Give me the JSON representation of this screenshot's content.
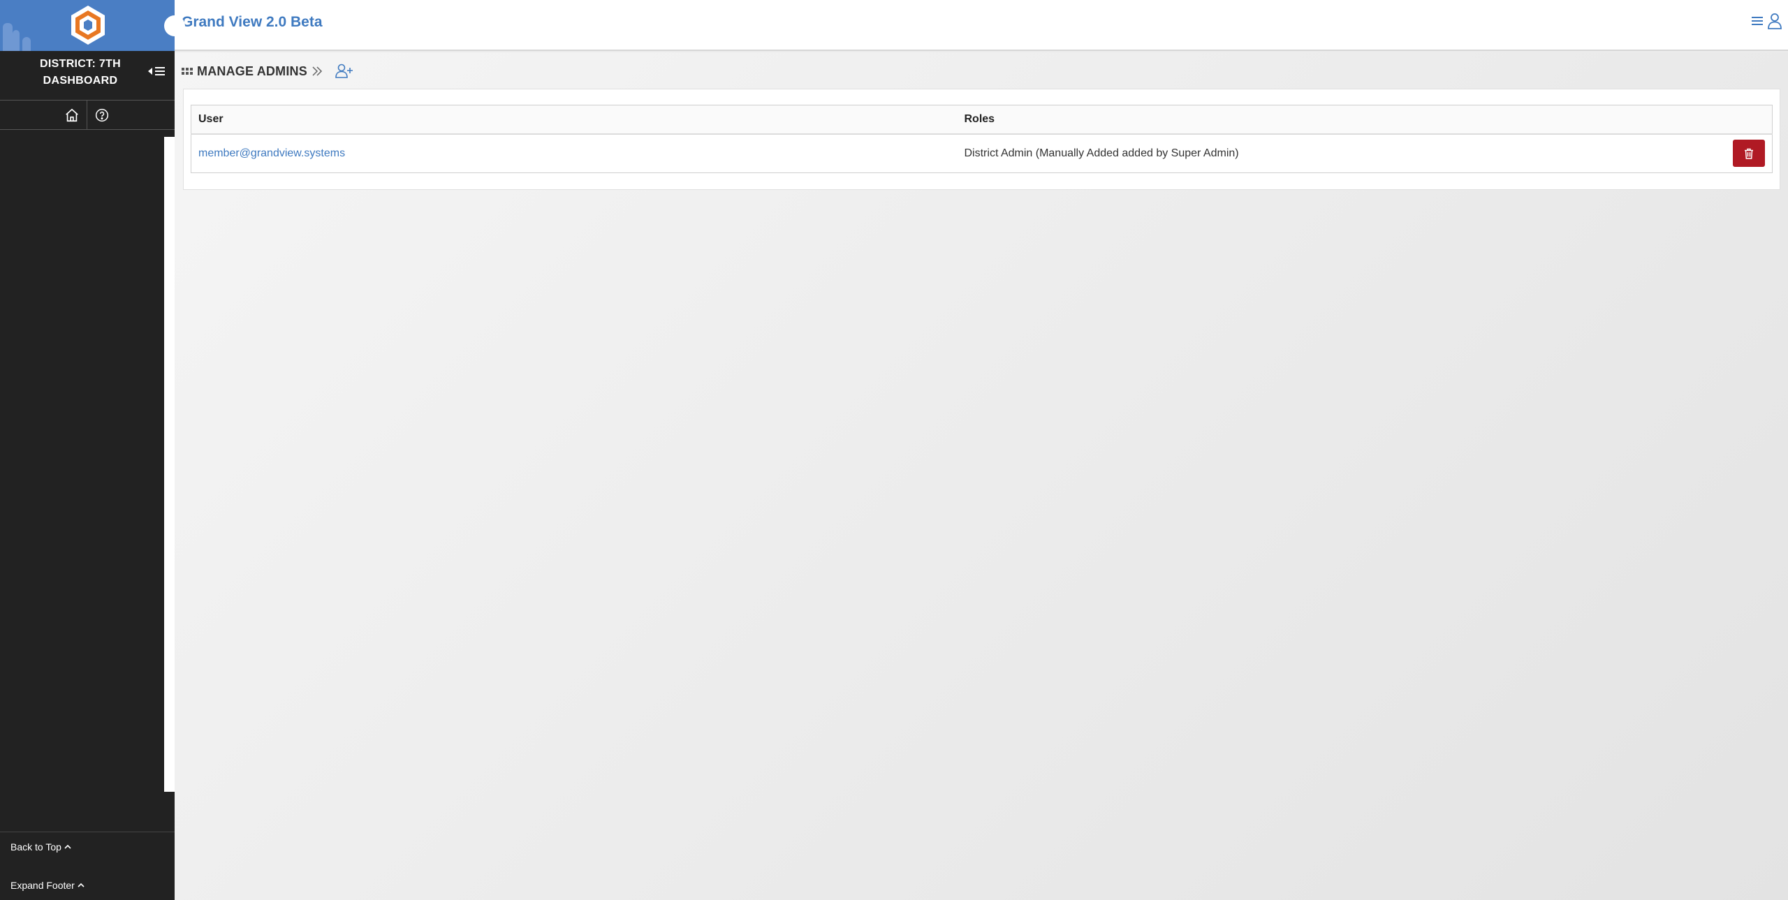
{
  "app": {
    "title": "Grand View 2.0 Beta"
  },
  "sidebar": {
    "district_line1": "DISTRICT: 7TH",
    "district_line2": "DASHBOARD",
    "back_to_top": "Back to Top",
    "expand_footer": "Expand Footer"
  },
  "page": {
    "title": "MANAGE ADMINS"
  },
  "table": {
    "headers": {
      "user": "User",
      "roles": "Roles"
    },
    "rows": [
      {
        "user": "member@grandview.systems",
        "roles": "District Admin (Manually Added added by Super Admin)"
      }
    ]
  },
  "colors": {
    "brand": "#4a7ec4",
    "sidebar": "#222222",
    "link": "#3f7ac0",
    "danger": "#b01a24",
    "logo_orange": "#e87722"
  }
}
